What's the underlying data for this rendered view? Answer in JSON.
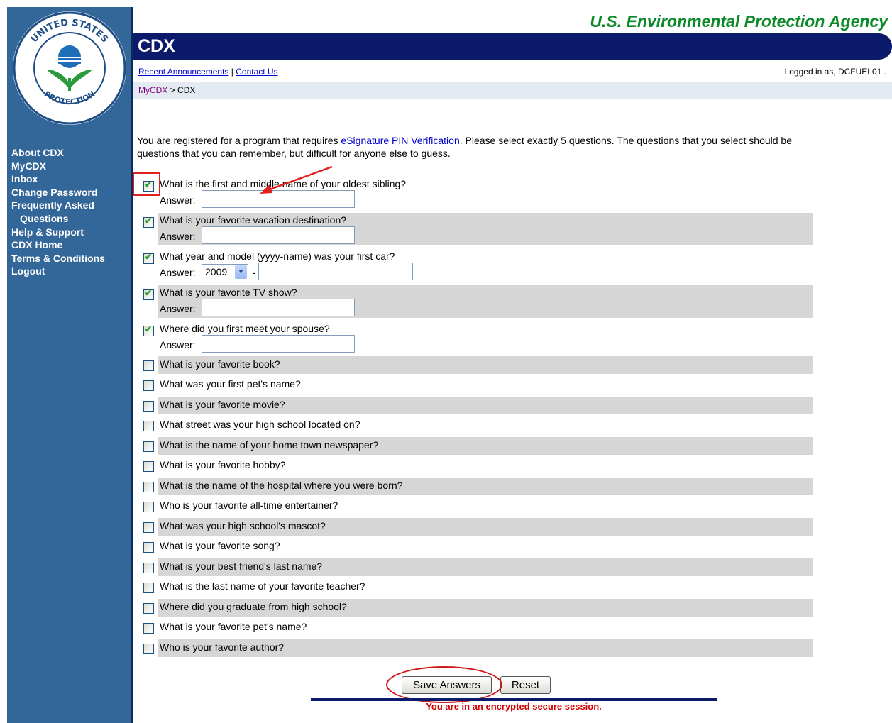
{
  "header": {
    "agency": "U.S. Environmental Protection Agency",
    "title": "CDX",
    "links": [
      "Recent Announcements",
      "Contact Us"
    ],
    "link_separator": "|",
    "logged_in": "Logged in as, DCFUEL01 ."
  },
  "seal": {
    "top_text": "UNITED STATES",
    "left_text": "ENVIRONMENTAL",
    "bottom_text": "PROTECTION",
    "right_text": "AGENCY"
  },
  "breadcrumb": {
    "home": "MyCDX",
    "sep": ">",
    "current": "CDX"
  },
  "sidebar": {
    "items": [
      "About CDX",
      "MyCDX",
      "Inbox",
      "Change Password",
      "Frequently Asked",
      "Questions",
      "Help & Support",
      "CDX Home",
      "Terms & Conditions",
      "Logout"
    ]
  },
  "intro": {
    "before": "You are registered for a program that requires ",
    "link": "eSignature PIN Verification",
    "after": ". Please select exactly 5 questions. The questions that you select should be questions that you can remember, but difficult for anyone else to guess."
  },
  "answer_label": "Answer:",
  "year_value": "2009",
  "dash": "-",
  "questions": [
    {
      "text": "What is the first and middle name of your oldest sibling?",
      "checked": true
    },
    {
      "text": "What is your favorite vacation destination?",
      "checked": true
    },
    {
      "text": "What year and model (yyyy-name) was your first car?",
      "checked": true
    },
    {
      "text": "What is your favorite TV show?",
      "checked": true
    },
    {
      "text": "Where did you first meet your spouse?",
      "checked": true
    },
    {
      "text": "What is your favorite book?",
      "checked": false
    },
    {
      "text": "What was your first pet's name?",
      "checked": false
    },
    {
      "text": "What is your favorite movie?",
      "checked": false
    },
    {
      "text": "What street was your high school located on?",
      "checked": false
    },
    {
      "text": "What is the name of your home town newspaper?",
      "checked": false
    },
    {
      "text": "What is your favorite hobby?",
      "checked": false
    },
    {
      "text": "What is the name of the hospital where you were born?",
      "checked": false
    },
    {
      "text": "Who is your favorite all-time entertainer?",
      "checked": false
    },
    {
      "text": "What was your high school's mascot?",
      "checked": false
    },
    {
      "text": "What is your favorite song?",
      "checked": false
    },
    {
      "text": "What is your best friend's last name?",
      "checked": false
    },
    {
      "text": "What is the last name of your favorite teacher?",
      "checked": false
    },
    {
      "text": "Where did you graduate from high school?",
      "checked": false
    },
    {
      "text": "What is your favorite pet's name?",
      "checked": false
    },
    {
      "text": "Who is your favorite author?",
      "checked": false
    }
  ],
  "buttons": {
    "save": "Save Answers",
    "reset": "Reset"
  },
  "footer": {
    "secure": "You are in an encrypted secure session."
  },
  "colors": {
    "sidebar": "#336699",
    "navy": "#0b1a6b",
    "agency_green": "#0c8a2a",
    "alert_red": "#d40000"
  }
}
